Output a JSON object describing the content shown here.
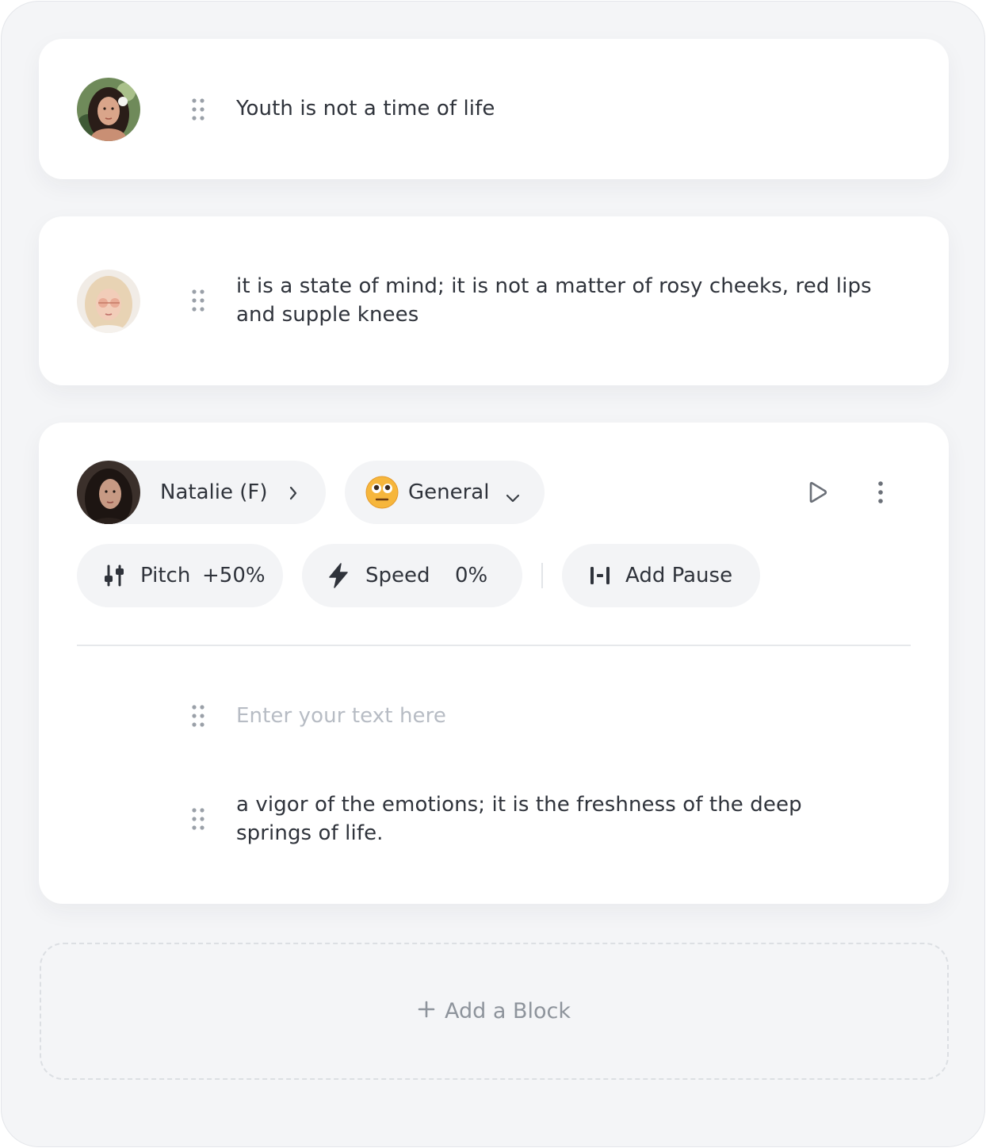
{
  "blocks": [
    {
      "avatar": "woman-dark-hair-flower-avatar",
      "text": "Youth is not a time of life"
    },
    {
      "avatar": "woman-blonde-sunglasses-avatar",
      "text_line1": "it is a state of mind; it is not a matter of rosy cheeks, red lips",
      "text_line2": "and supple knees"
    }
  ],
  "active_block": {
    "voice": {
      "name": "Natalie (F)",
      "avatar": "woman-brunette-avatar"
    },
    "style": {
      "label": "General",
      "emoji": "😐"
    },
    "pitch": {
      "label": "Pitch",
      "value": "+50%"
    },
    "speed": {
      "label": "Speed",
      "value": "0%"
    },
    "pause": {
      "label": "Add Pause"
    },
    "input": {
      "placeholder": "Enter your text here"
    },
    "lines": [
      {
        "text_line1": "a vigor of the emotions; it is the freshness of the deep",
        "text_line2": "springs of life."
      }
    ]
  },
  "add_block": {
    "label": "Add a Block"
  },
  "colors": {
    "background": "#f4f5f7",
    "card": "#ffffff",
    "pill": "#f3f4f6",
    "text": "#2f333b",
    "muted": "#8e949c",
    "placeholder": "#b7bcc4"
  }
}
